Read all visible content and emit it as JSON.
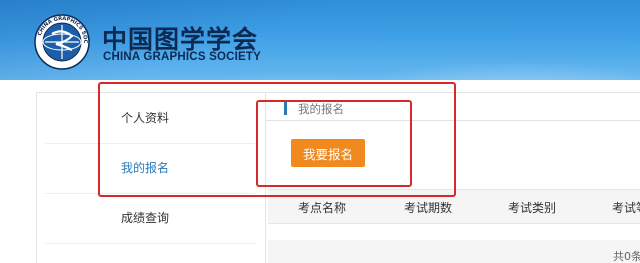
{
  "header": {
    "logo_name": "csg-logo-icon",
    "title_cn": "中国图学学会",
    "title_en": "CHINA GRAPHICS SOCIETY",
    "logo_ring_text": "CHINA GRAPHICS SOCIETY"
  },
  "sidebar": {
    "items": [
      {
        "label": "个人资料",
        "active": false
      },
      {
        "label": "我的报名",
        "active": true
      },
      {
        "label": "成绩查询",
        "active": false
      }
    ]
  },
  "main": {
    "breadcrumb": "我的报名",
    "signup_button": "我要报名",
    "table": {
      "columns": [
        "考点名称",
        "考试期数",
        "考试类别",
        "考试等级"
      ]
    },
    "total_text": "共0条"
  },
  "colors": {
    "header_blue": "#3fa0e6",
    "accent": "#2a7ab8",
    "button_orange": "#f08a1f",
    "annotation_red": "#d42a2a"
  }
}
